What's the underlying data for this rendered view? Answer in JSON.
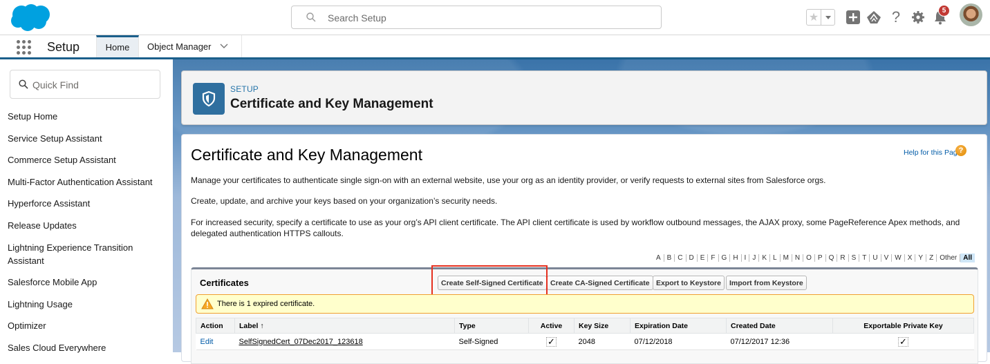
{
  "header": {
    "search_placeholder": "Search Setup",
    "notification_count": "5",
    "icons": [
      "favorites-star-icon",
      "favorites-dropdown-icon",
      "add-icon",
      "trailhead-icon",
      "help-icon",
      "gear-icon",
      "bell-icon",
      "avatar"
    ]
  },
  "context_bar": {
    "app_name": "Setup",
    "tabs": [
      {
        "label": "Home",
        "active": true
      },
      {
        "label": "Object Manager",
        "active": false
      }
    ]
  },
  "sidebar": {
    "quick_find_placeholder": "Quick Find",
    "items": [
      {
        "label": "Setup Home"
      },
      {
        "label": "Service Setup Assistant"
      },
      {
        "label": "Commerce Setup Assistant"
      },
      {
        "label": "Multi-Factor Authentication Assistant"
      },
      {
        "label": "Hyperforce Assistant"
      },
      {
        "label": "Release Updates"
      },
      {
        "label": "Lightning Experience Transition Assistant"
      },
      {
        "label": "Salesforce Mobile App"
      },
      {
        "label": "Lightning Usage"
      },
      {
        "label": "Optimizer"
      },
      {
        "label": "Sales Cloud Everywhere"
      }
    ]
  },
  "page_header": {
    "eyebrow": "SETUP",
    "title": "Certificate and Key Management"
  },
  "main": {
    "title": "Certificate and Key Management",
    "help_link": "Help for this Page",
    "descriptions": [
      "Manage your certificates to authenticate single sign-on with an external website, use your org as an identity provider, or verify requests to external sites from Salesforce orgs.",
      "Create, update, and archive your keys based on your organization’s security needs.",
      "For increased security, specify a certificate to use as your org’s API client certificate. The API client certificate is used by workflow outbound messages, the AJAX proxy, some PageReference Apex methods, and delegated authentication HTTPS callouts."
    ],
    "alpha_filter": [
      "A",
      "B",
      "C",
      "D",
      "E",
      "F",
      "G",
      "H",
      "I",
      "J",
      "K",
      "L",
      "M",
      "N",
      "O",
      "P",
      "Q",
      "R",
      "S",
      "T",
      "U",
      "V",
      "W",
      "X",
      "Y",
      "Z",
      "Other",
      "All"
    ],
    "alpha_active": "All",
    "certificates": {
      "title": "Certificates",
      "buttons": {
        "create_self_signed": "Create Self-Signed Certificate",
        "create_ca_signed": "Create CA-Signed Certificate",
        "export_keystore": "Export to Keystore",
        "import_keystore": "Import from Keystore"
      },
      "warning": "There is 1 expired certificate.",
      "columns": [
        "Action",
        "Label ↑",
        "Type",
        "Active",
        "Key Size",
        "Expiration Date",
        "Created Date",
        "Exportable Private Key"
      ],
      "rows": [
        {
          "action": "Edit",
          "label": "SelfSignedCert_07Dec2017_123618",
          "type": "Self-Signed",
          "active": "✓",
          "key_size": "2048",
          "expiration_date": "07/12/2018",
          "created_date": "07/12/2017 12:36",
          "exportable_private_key": "✓"
        }
      ]
    }
  },
  "colors": {
    "brand_blue": "#1b5f8b",
    "link_blue": "#015ba7",
    "expired_red": "#e00000",
    "highlight_red": "#e5301f",
    "warning_bg": "#ffffcc"
  }
}
